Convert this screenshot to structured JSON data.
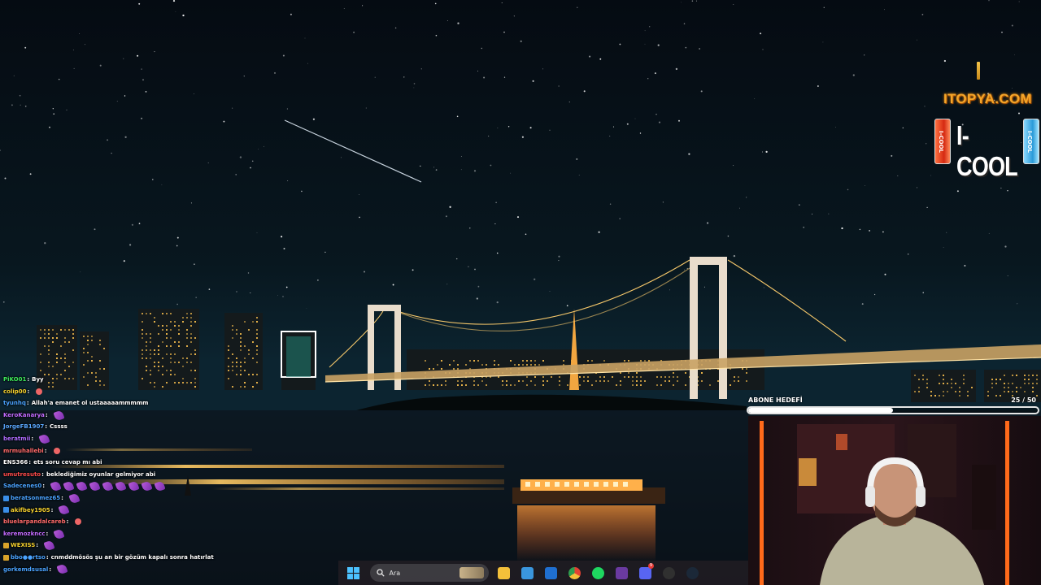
{
  "chat": {
    "messages": [
      {
        "user": "PiKO01",
        "user_color": "#3ee85a",
        "message": "Byy",
        "emote": "",
        "badge": ""
      },
      {
        "user": "colip00",
        "user_color": "#f5d12e",
        "message": "",
        "emote": "small",
        "badge": ""
      },
      {
        "user": "tyunhq",
        "user_color": "#4aa3ff",
        "message": "Allah'a emanet ol ustaaaaammmmm",
        "emote": "",
        "badge": ""
      },
      {
        "user": "KeroKanarya",
        "user_color": "#c26bff",
        "message": "",
        "emote": "purple",
        "badge": ""
      },
      {
        "user": "JorgeFB1907",
        "user_color": "#5aa8ff",
        "message": "Cssss",
        "emote": "",
        "badge": ""
      },
      {
        "user": "beratmii",
        "user_color": "#b06cff",
        "message": "",
        "emote": "purple",
        "badge": ""
      },
      {
        "user": "mrmuhallebi",
        "user_color": "#ff6b6b",
        "message": "",
        "emote": "small",
        "badge": ""
      },
      {
        "user": "ENS366",
        "user_color": "#ffffff",
        "message": "ets soru cevap mı abi",
        "emote": "",
        "badge": ""
      },
      {
        "user": "umutresuto",
        "user_color": "#ff4b4b",
        "message": "beklediğimiz oyunlar gelmiyor abi",
        "emote": "",
        "badge": ""
      },
      {
        "user": "Sadecenes0",
        "user_color": "#4aa3ff",
        "message": "",
        "emote": "purple-row",
        "badge": ""
      },
      {
        "user": "beratsonmez65",
        "user_color": "#4aa3ff",
        "message": "",
        "emote": "purple",
        "badge": "blue"
      },
      {
        "user": "akifbey1905",
        "user_color": "#f5d12e",
        "message": "",
        "emote": "purple",
        "badge": "blue"
      },
      {
        "user": "bluelarpandalcareb",
        "user_color": "#ff6b6b",
        "message": "",
        "emote": "small",
        "badge": ""
      },
      {
        "user": "keremozkncc",
        "user_color": "#c26bff",
        "message": "",
        "emote": "purple",
        "badge": ""
      },
      {
        "user": "WEXISS",
        "user_color": "#f5d12e",
        "message": "",
        "emote": "purple",
        "badge": "gold"
      },
      {
        "user": "bbo●●rtso",
        "user_color": "#4aa3ff",
        "message": "cnmddmösös şu an bir gözüm kapalı sonra hatırlat",
        "emote": "",
        "badge": "gold"
      },
      {
        "user": "gorkemdsusal",
        "user_color": "#4aa3ff",
        "message": "",
        "emote": "purple",
        "badge": ""
      }
    ]
  },
  "sponsor": {
    "site": "ITOPYA.COM",
    "brand": "I-COOL",
    "can_label": "I-COOL"
  },
  "sub_goal": {
    "label": "ABONE HEDEFİ",
    "current": "25",
    "separator": "/",
    "target": "50",
    "progress": 0.5
  },
  "taskbar": {
    "search_placeholder": "Ara",
    "apps": [
      {
        "name": "file-explorer-icon",
        "color": "#f4c03a"
      },
      {
        "name": "microsoft-store-icon",
        "color": "#3a96dd"
      },
      {
        "name": "outlook-icon",
        "color": "#1f6fd0"
      },
      {
        "name": "chrome-icon",
        "color": "#e34133"
      },
      {
        "name": "spotify-icon",
        "color": "#1ed760"
      },
      {
        "name": "next-app-icon",
        "color": "#6a3aa0"
      },
      {
        "name": "discord-icon",
        "color": "#5865f2"
      },
      {
        "name": "obs-icon",
        "color": "#303030"
      },
      {
        "name": "steam-icon",
        "color": "#1b2838"
      }
    ],
    "discord_badge": "9"
  },
  "colors": {
    "sky_top": "#04090f",
    "sky_bottom": "#0b2230",
    "bridge_lights": "#f5c76a",
    "water": "#0c1820",
    "webcam_accent": "#ff6a1a"
  }
}
